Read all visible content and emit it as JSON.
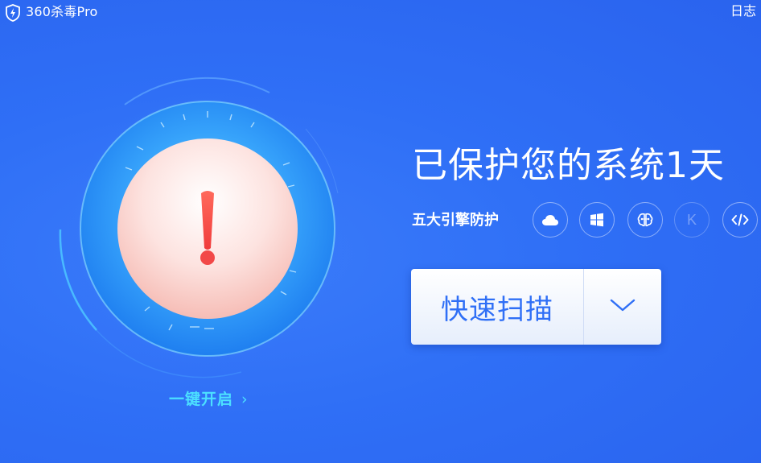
{
  "app": {
    "title": "360杀毒Pro",
    "log_label": "日志"
  },
  "status": {
    "title": "已保护您的系统1天",
    "engines_label": "五大引擎防护",
    "engines": [
      {
        "icon": "cloud-icon",
        "active": true
      },
      {
        "icon": "windows-icon",
        "active": true
      },
      {
        "icon": "brain-icon",
        "active": true
      },
      {
        "icon": "k-engine-icon",
        "letter": "K",
        "active": false
      },
      {
        "icon": "code-icon",
        "active": true
      }
    ]
  },
  "dial": {
    "alert_icon": "exclamation-icon",
    "one_click_label": "一键开启",
    "one_click_chevron": "›"
  },
  "scan": {
    "label": "快速扫描",
    "dropdown_icon": "chevron-down-icon"
  },
  "colors": {
    "background": "#2f6ff6",
    "accent_cyan": "#4ce0ff",
    "alert_red": "#f24848",
    "button_text": "#2f6ff6"
  }
}
